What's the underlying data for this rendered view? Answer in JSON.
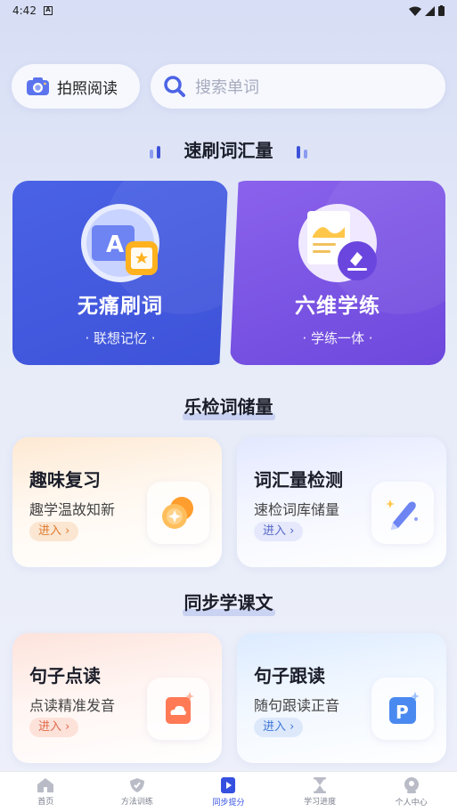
{
  "status": {
    "time": "4:42",
    "notif": "A"
  },
  "top": {
    "photo_label": "拍照阅读",
    "search_placeholder": "搜索单词"
  },
  "sections": {
    "s1": "速刷词汇量",
    "s2": "乐检词储量",
    "s3": "同步学课文"
  },
  "big_cards": [
    {
      "name": "无痛刷词",
      "sub": "· 联想记忆 ·",
      "icon_letter": "A"
    },
    {
      "name": "六维学练",
      "sub": "· 学练一体 ·"
    }
  ],
  "cards": [
    {
      "title": "趣味复习",
      "desc": "趣学温故知新",
      "enter": "进入"
    },
    {
      "title": "词汇量检测",
      "desc": "速检词库储量",
      "enter": "进入"
    },
    {
      "title": "句子点读",
      "desc": "点读精准发音",
      "enter": "进入"
    },
    {
      "title": "句子跟读",
      "desc": "随句跟读正音",
      "enter": "进入",
      "icon_letter": "P"
    }
  ],
  "nav": [
    {
      "label": "首页",
      "icon": "home-icon"
    },
    {
      "label": "方法训练",
      "icon": "shield-icon"
    },
    {
      "label": "同步提分",
      "icon": "book-play-icon",
      "active": true
    },
    {
      "label": "学习进度",
      "icon": "hourglass-icon"
    },
    {
      "label": "个人中心",
      "icon": "user-icon"
    }
  ],
  "colors": {
    "accent": "#3550e0",
    "card_blue": "#4a62e6",
    "card_purple": "#7c55e6"
  }
}
